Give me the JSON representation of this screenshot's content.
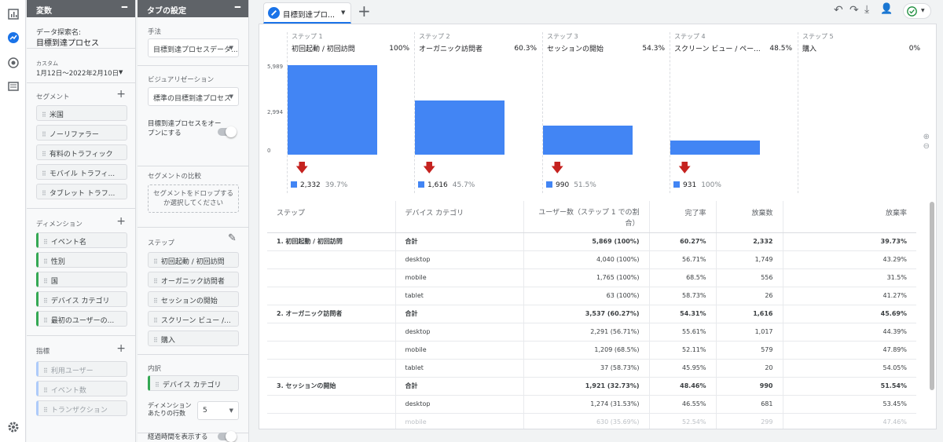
{
  "panels": {
    "variables": {
      "title": "変数",
      "exploration_label": "データ探索名:",
      "exploration_name": "目標到達プロセス",
      "date_custom": "カスタム",
      "date_range": "1月12日～2022年2月10日",
      "segments_title": "セグメント",
      "segments": [
        "米国",
        "ノーリファラー",
        "有料のトラフィック",
        "モバイル トラフィ...",
        "タブレット トラフ..."
      ],
      "dimensions_title": "ディメンション",
      "dimensions": [
        "イベント名",
        "性別",
        "国",
        "デバイス カテゴリ",
        "最初のユーザーの..."
      ],
      "metrics_title": "指標",
      "metrics": [
        "利用ユーザー",
        "イベント数",
        "トランザクション"
      ]
    },
    "tab_settings": {
      "title": "タブの設定",
      "technique_label": "手法",
      "technique_value": "目標到達プロセスデータ...",
      "viz_label": "ビジュアリゼーション",
      "viz_value": "標準の目標到達プロセス",
      "open_funnel_label": "目標到達プロセスをオープンにする",
      "segment_compare_label": "セグメントの比較",
      "segment_drop_text": "セグメントをドロップするか選択してください",
      "steps_label": "ステップ",
      "steps": [
        "初回起動 / 初回訪問",
        "オーガニック訪問者",
        "セッションの開始",
        "スクリーン ビュー /...",
        "購入"
      ],
      "breakdown_label": "内訳",
      "breakdown_value": "デバイス カテゴリ",
      "rows_per_dim_label": "ディメンションあたりの行数",
      "rows_per_dim_value": "5",
      "elapsed_label": "経過時間を表示する"
    }
  },
  "tab": {
    "name": "目標到達プロ...",
    "add": "+"
  },
  "funnel": {
    "y_ticks": [
      "5,989",
      "2,994",
      "0"
    ],
    "steps": [
      {
        "step": "ステップ 1",
        "name": "初回起動 / 初回訪問",
        "pct": "100%",
        "users": 5869,
        "abandon": "2,332",
        "abandon_pct": "39.7%"
      },
      {
        "step": "ステップ 2",
        "name": "オーガニック訪問者",
        "pct": "60.3%",
        "users": 3537,
        "abandon": "1,616",
        "abandon_pct": "45.7%"
      },
      {
        "step": "ステップ 3",
        "name": "セッションの開始",
        "pct": "54.3%",
        "users": 1921,
        "abandon": "990",
        "abandon_pct": "51.5%"
      },
      {
        "step": "ステップ 4",
        "name": "スクリーン ビュー / ペー...",
        "pct": "48.5%",
        "users": 931,
        "abandon": "931",
        "abandon_pct": "100%"
      },
      {
        "step": "ステップ 5",
        "name": "購入",
        "pct": "0%",
        "users": 0
      }
    ],
    "y_max": 5989
  },
  "table": {
    "headers": [
      "ステップ",
      "デバイス カテゴリ",
      "ユーザー数（ステップ 1 での割合）",
      "完了率",
      "放棄数",
      "放棄率"
    ],
    "rows": [
      [
        "1. 初回起動 / 初回訪問",
        "合計",
        "5,869 (100%)",
        "60.27%",
        "2,332",
        "39.73%"
      ],
      [
        "",
        "desktop",
        "4,040 (100%)",
        "56.71%",
        "1,749",
        "43.29%"
      ],
      [
        "",
        "mobile",
        "1,765 (100%)",
        "68.5%",
        "556",
        "31.5%"
      ],
      [
        "",
        "tablet",
        "63 (100%)",
        "58.73%",
        "26",
        "41.27%"
      ],
      [
        "2. オーガニック訪問者",
        "合計",
        "3,537 (60.27%)",
        "54.31%",
        "1,616",
        "45.69%"
      ],
      [
        "",
        "desktop",
        "2,291 (56.71%)",
        "55.61%",
        "1,017",
        "44.39%"
      ],
      [
        "",
        "mobile",
        "1,209 (68.5%)",
        "52.11%",
        "579",
        "47.89%"
      ],
      [
        "",
        "tablet",
        "37 (58.73%)",
        "45.95%",
        "20",
        "54.05%"
      ],
      [
        "3. セッションの開始",
        "合計",
        "1,921 (32.73%)",
        "48.46%",
        "990",
        "51.54%"
      ],
      [
        "",
        "desktop",
        "1,274 (31.53%)",
        "46.55%",
        "681",
        "53.45%"
      ],
      [
        "",
        "mobile",
        "630 (35.69%)",
        "52.54%",
        "299",
        "47.46%"
      ]
    ]
  },
  "chart_data": {
    "type": "bar",
    "categories": [
      "初回起動 / 初回訪問",
      "オーガニック訪問者",
      "セッションの開始",
      "スクリーン ビュー / ペー...",
      "購入"
    ],
    "values": [
      5869,
      3537,
      1921,
      931,
      0
    ],
    "ylim": [
      0,
      5989
    ],
    "title": "",
    "xlabel": "",
    "ylabel": ""
  }
}
